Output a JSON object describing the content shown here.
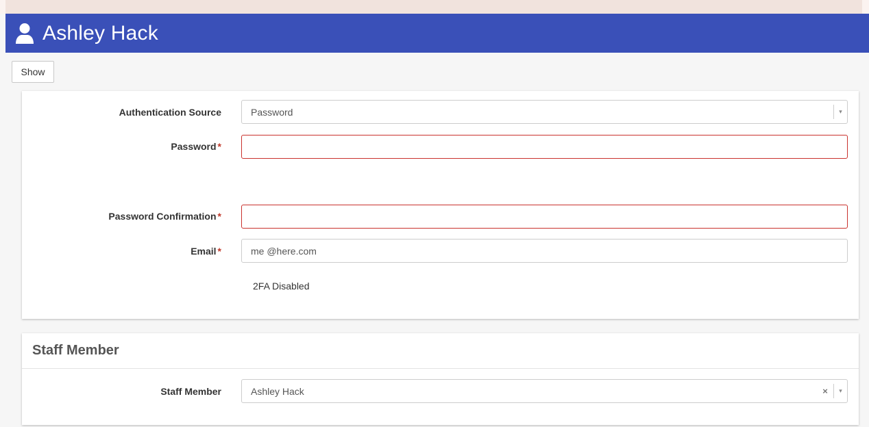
{
  "header": {
    "title": "Ashley Hack",
    "background_color": "#3a50b8",
    "icon": "user-icon"
  },
  "toolbar": {
    "show_label": "Show"
  },
  "auth_form": {
    "authentication_source": {
      "label": "Authentication Source",
      "value": "Password",
      "arrow": "▾"
    },
    "password": {
      "label": "Password",
      "required_mark": "*",
      "value": ""
    },
    "password_confirmation": {
      "label": "Password Confirmation",
      "required_mark": "*",
      "value": ""
    },
    "email": {
      "label": "Email",
      "required_mark": "*",
      "value": "me @here.com"
    },
    "twofa_status": "2FA Disabled"
  },
  "staff_section": {
    "heading": "Staff Member",
    "staff_member": {
      "label": "Staff Member",
      "value": "Ashley Hack",
      "clear": "×",
      "arrow": "▾"
    }
  },
  "colors": {
    "error_border": "#c9302c",
    "required_mark": "#c0392b"
  }
}
